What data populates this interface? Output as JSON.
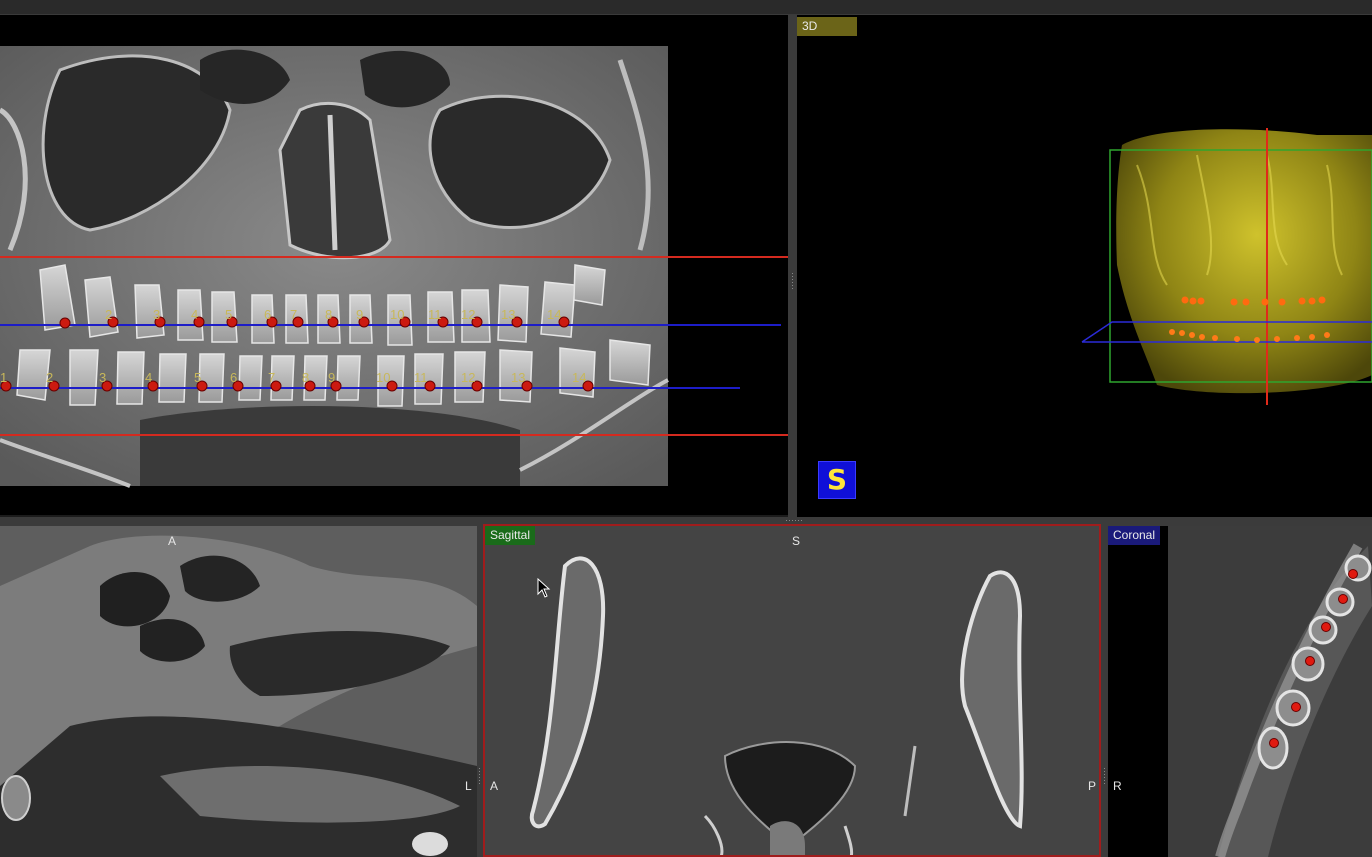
{
  "views": {
    "panoramic": {
      "upper_tooth_numbers": [
        "1",
        "2",
        "3",
        "4",
        "5",
        "6",
        "7",
        "8",
        "9",
        "10",
        "11",
        "12",
        "13",
        "14"
      ],
      "lower_tooth_numbers": [
        "1",
        "2",
        "3",
        "4",
        "5",
        "6",
        "7",
        "8",
        "9",
        "10",
        "11",
        "12",
        "13",
        "14"
      ],
      "colors": {
        "bounds_line": "#d42a1f",
        "arch_line": "#1d1dc8",
        "point": "#cc1a10",
        "label": "#c8b85a"
      }
    },
    "three_d": {
      "label": "3D",
      "orientation_badge": "S",
      "label_bg": "#6b6418"
    },
    "axial": {
      "top_label": "A",
      "right_label": "L"
    },
    "sagittal": {
      "label": "Sagittal",
      "top_label": "S",
      "left_label": "A",
      "right_label": "P",
      "label_bg": "#1a6b1a",
      "border": "#a01c1c"
    },
    "coronal": {
      "label": "Coronal",
      "left_label": "R",
      "label_bg": "#1a1a7a"
    }
  }
}
